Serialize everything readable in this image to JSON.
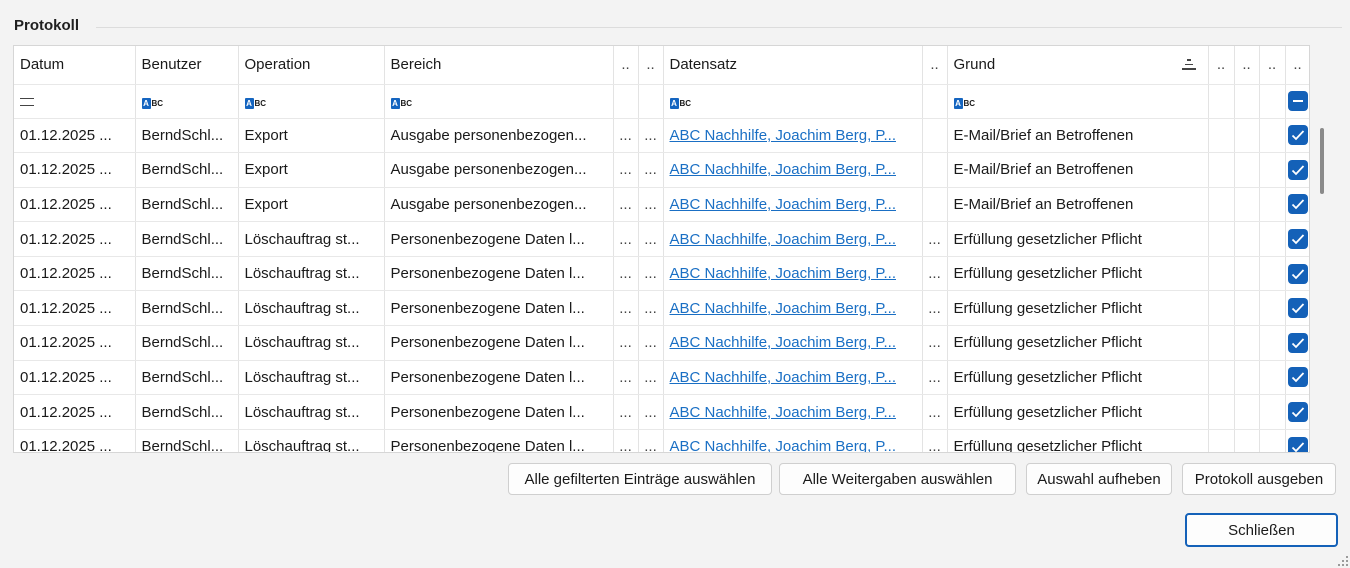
{
  "group": {
    "title": "Protokoll"
  },
  "columns": [
    "Datum",
    "Benutzer",
    "Operation",
    "Bereich",
    "..",
    "..",
    "Datensatz",
    "..",
    "Grund",
    "..",
    "..",
    "..",
    ".."
  ],
  "rows": [
    [
      "01.12.2025 ...",
      "BerndSchl...",
      "Export",
      "Ausgabe personenbezogen...",
      "...",
      "...",
      "ABC Nachhilfe, Joachim Berg, P...",
      "",
      "E-Mail/Brief an Betroffenen"
    ],
    [
      "01.12.2025 ...",
      "BerndSchl...",
      "Export",
      "Ausgabe personenbezogen...",
      "...",
      "...",
      "ABC Nachhilfe, Joachim Berg, P...",
      "",
      "E-Mail/Brief an Betroffenen"
    ],
    [
      "01.12.2025 ...",
      "BerndSchl...",
      "Export",
      "Ausgabe personenbezogen...",
      "...",
      "...",
      "ABC Nachhilfe, Joachim Berg, P...",
      "",
      "E-Mail/Brief an Betroffenen"
    ],
    [
      "01.12.2025 ...",
      "BerndSchl...",
      "Löschauftrag st...",
      "Personenbezogene Daten l...",
      "...",
      "...",
      "ABC Nachhilfe, Joachim Berg, P...",
      "...",
      "Erfüllung gesetzlicher Pflicht"
    ],
    [
      "01.12.2025 ...",
      "BerndSchl...",
      "Löschauftrag st...",
      "Personenbezogene Daten l...",
      "...",
      "...",
      "ABC Nachhilfe, Joachim Berg, P...",
      "...",
      "Erfüllung gesetzlicher Pflicht"
    ],
    [
      "01.12.2025 ...",
      "BerndSchl...",
      "Löschauftrag st...",
      "Personenbezogene Daten l...",
      "...",
      "...",
      "ABC Nachhilfe, Joachim Berg, P...",
      "...",
      "Erfüllung gesetzlicher Pflicht"
    ],
    [
      "01.12.2025 ...",
      "BerndSchl...",
      "Löschauftrag st...",
      "Personenbezogene Daten l...",
      "...",
      "...",
      "ABC Nachhilfe, Joachim Berg, P...",
      "...",
      "Erfüllung gesetzlicher Pflicht"
    ],
    [
      "01.12.2025 ...",
      "BerndSchl...",
      "Löschauftrag st...",
      "Personenbezogene Daten l...",
      "...",
      "...",
      "ABC Nachhilfe, Joachim Berg, P...",
      "...",
      "Erfüllung gesetzlicher Pflicht"
    ],
    [
      "01.12.2025 ...",
      "BerndSchl...",
      "Löschauftrag st...",
      "Personenbezogene Daten l...",
      "...",
      "...",
      "ABC Nachhilfe, Joachim Berg, P...",
      "...",
      "Erfüllung gesetzlicher Pflicht"
    ],
    [
      "01.12.2025 ...",
      "BerndSchl...",
      "Löschauftrag st...",
      "Personenbezogene Daten l...",
      "...",
      "...",
      "ABC Nachhilfe, Joachim Berg, P...",
      "...",
      "Erfüllung gesetzlicher Pflicht"
    ]
  ],
  "filter_icon_label": "BC",
  "filter_icon_letter": "A",
  "buttons": {
    "select_filtered": "Alle gefilterten Einträge auswählen",
    "select_shares": "Alle Weitergaben auswählen",
    "clear_selection": "Auswahl aufheben",
    "print_log": "Protokoll ausgeben",
    "close": "Schließen"
  },
  "colors": {
    "accent": "#1461b8",
    "link": "#1a6fc4"
  }
}
